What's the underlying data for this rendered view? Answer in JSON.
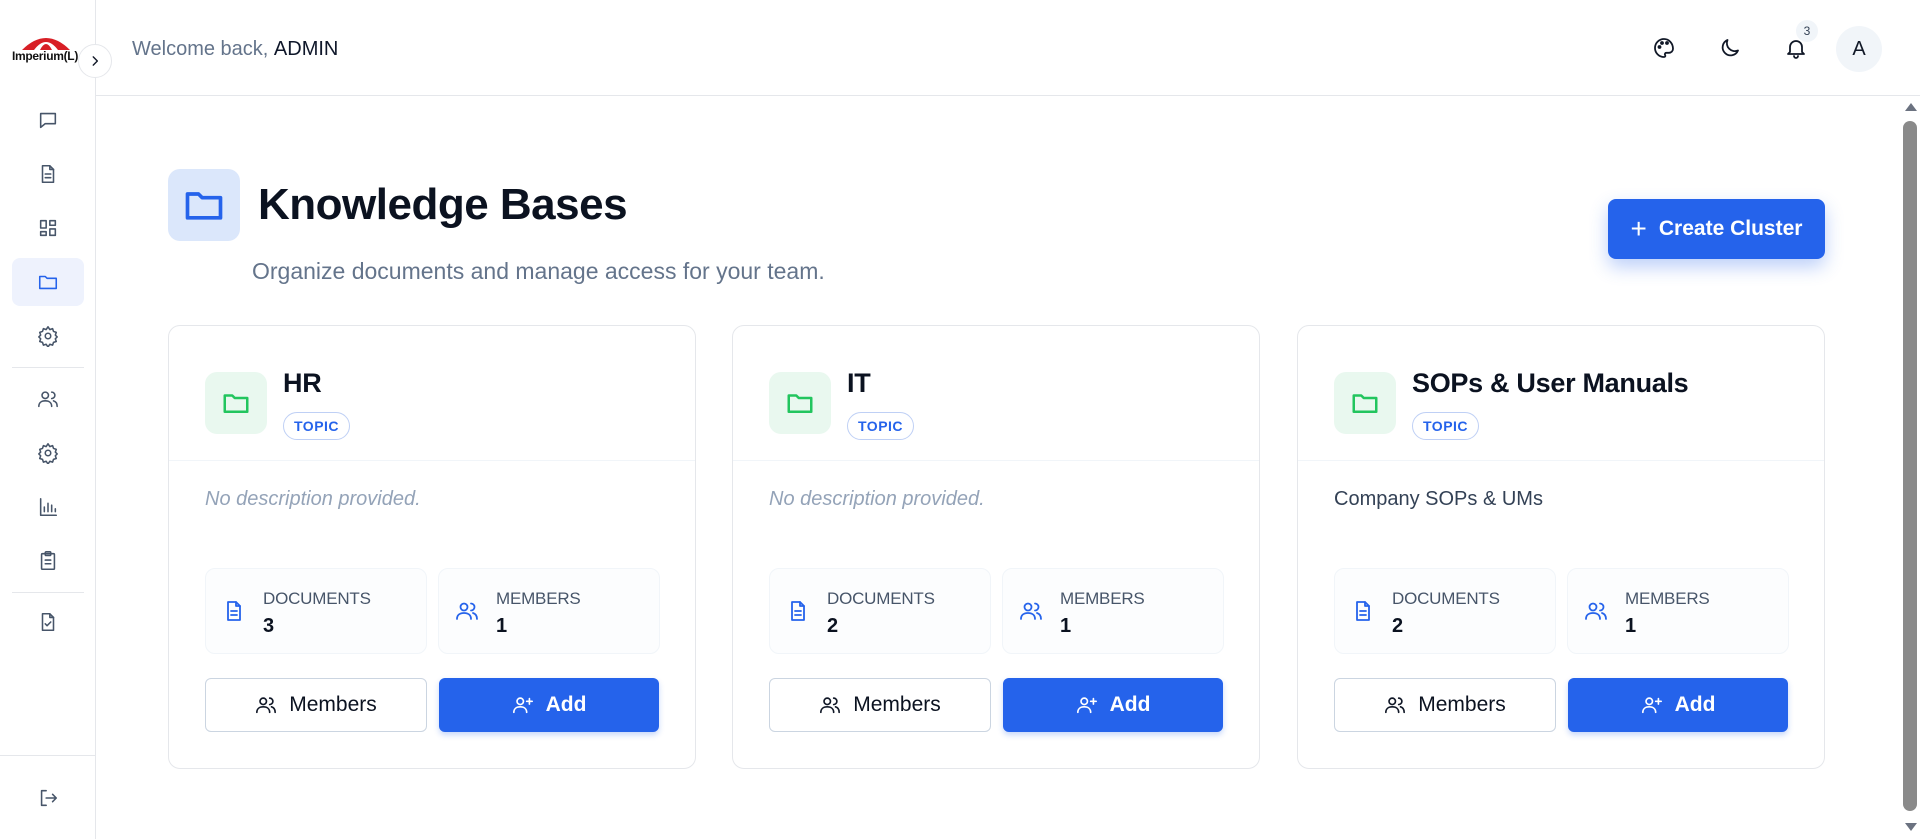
{
  "app": {
    "logo_text": "Imperium(L)",
    "brand_color": "#d81f26",
    "accent_color": "#2563eb"
  },
  "header": {
    "welcome_prefix": "Welcome back,",
    "username": "ADMIN",
    "notification_count": "3",
    "avatar_initial": "A",
    "icons": [
      "palette-icon",
      "moon-icon",
      "bell-icon"
    ]
  },
  "sidebar": {
    "items": [
      {
        "icon": "chat-icon",
        "active": false
      },
      {
        "icon": "document-icon",
        "active": false
      },
      {
        "icon": "dashboard-icon",
        "active": false
      },
      {
        "icon": "folder-icon",
        "active": true
      },
      {
        "icon": "settings-icon",
        "active": false
      },
      {
        "icon": "users-icon",
        "active": false
      },
      {
        "icon": "settings-icon",
        "active": false
      },
      {
        "icon": "bar-chart-icon",
        "active": false
      },
      {
        "icon": "clipboard-icon",
        "active": false
      },
      {
        "icon": "file-check-icon",
        "active": false
      },
      {
        "icon": "logout-icon",
        "active": false
      }
    ]
  },
  "main": {
    "title": "Knowledge Bases",
    "subtitle": "Organize documents and manage access for your team.",
    "create_button_label": "Create Cluster"
  },
  "cards": [
    {
      "title": "HR",
      "tag": "TOPIC",
      "description": "No description provided.",
      "documents_label": "DOCUMENTS",
      "documents_count": "3",
      "members_label": "MEMBERS",
      "members_count": "1",
      "members_button": "Members",
      "add_button": "Add"
    },
    {
      "title": "IT",
      "tag": "TOPIC",
      "description": "No description provided.",
      "documents_label": "DOCUMENTS",
      "documents_count": "2",
      "members_label": "MEMBERS",
      "members_count": "1",
      "members_button": "Members",
      "add_button": "Add"
    },
    {
      "title": "SOPs & User Manuals",
      "tag": "TOPIC",
      "description": "Company SOPs & UMs",
      "documents_label": "DOCUMENTS",
      "documents_count": "2",
      "members_label": "MEMBERS",
      "members_count": "1",
      "members_button": "Members",
      "add_button": "Add"
    }
  ]
}
